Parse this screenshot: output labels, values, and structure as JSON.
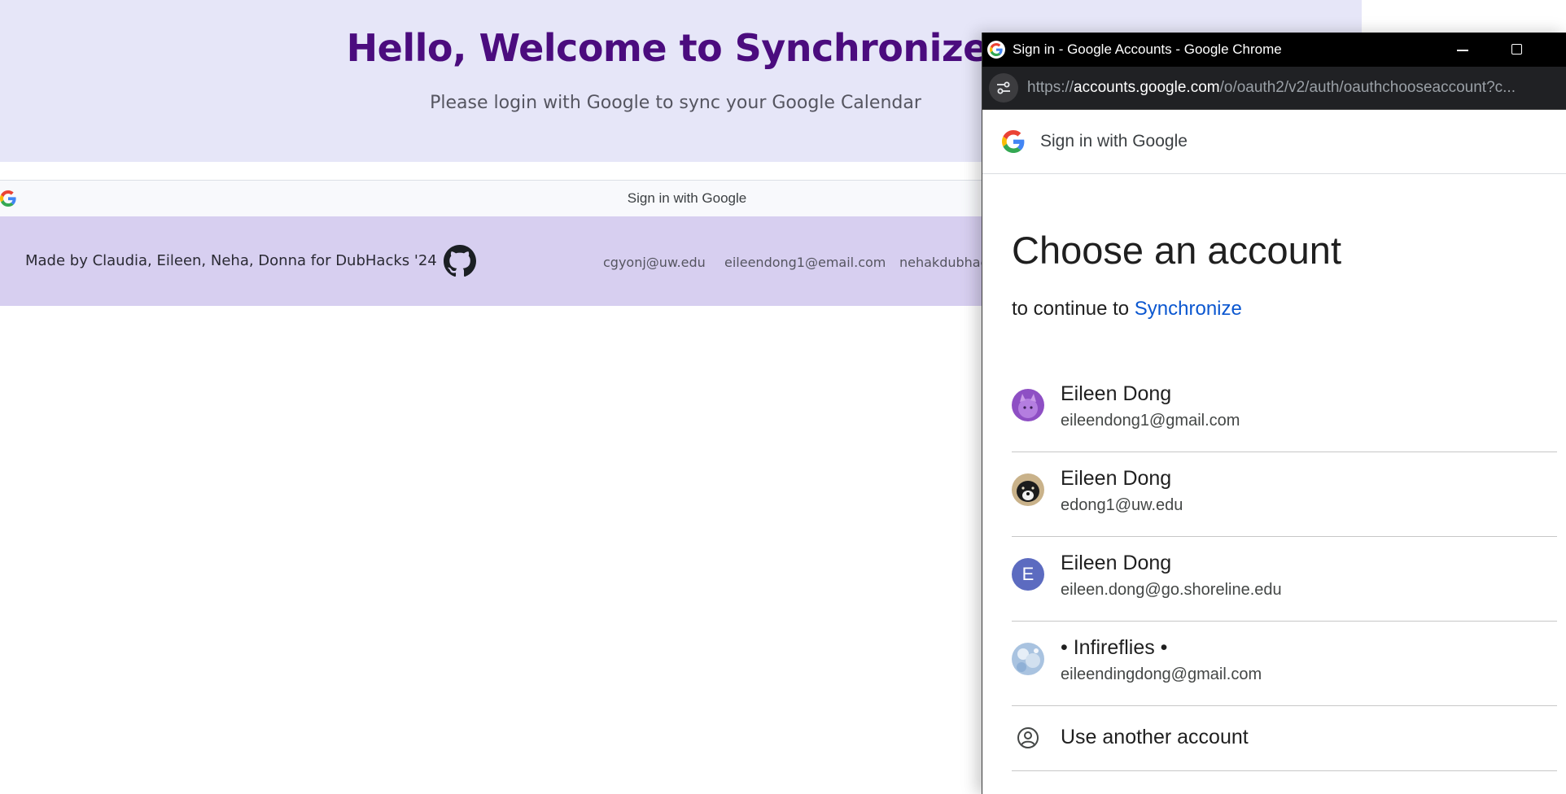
{
  "page": {
    "hero_title": "Hello, Welcome to Synchronize!",
    "hero_subtitle": "Please login with Google to sync your Google Calendar",
    "google_signin_label": "Sign in with Google",
    "footer": {
      "made_by": "Made by Claudia, Eileen, Neha, Donna for DubHacks '24",
      "github_icon": "github-icon",
      "emails": [
        "cgyonj@uw.edu",
        "eileendong1@email.com",
        "nehakdubhacks"
      ]
    },
    "colors": {
      "hero_bg": "#e6e6f8",
      "hero_title": "#4b0c7e",
      "footer_bg": "#d7cff0"
    }
  },
  "popup": {
    "window_title": "Sign in - Google Accounts - Google Chrome",
    "url_scheme": "https://",
    "url_host": "accounts.google.com",
    "url_path": "/o/oauth2/v2/auth/oauthchooseaccount?c...",
    "header_label": "Sign in with Google",
    "title": "Choose an account",
    "continue_prefix": "to continue to",
    "app_name": "Synchronize",
    "accounts": [
      {
        "name": "Eileen Dong",
        "email": "eileendong1@gmail.com",
        "avatar": "cat-photo-avatar"
      },
      {
        "name": "Eileen Dong",
        "email": "edong1@uw.edu",
        "avatar": "dog-photo-avatar"
      },
      {
        "name": "Eileen Dong",
        "email": "eileen.dong@go.shoreline.edu",
        "avatar": "letter-avatar",
        "letter": "E"
      },
      {
        "name": "• Infireflies •",
        "email": "eileendingdong@gmail.com",
        "avatar": "sky-photo-avatar"
      }
    ],
    "use_another": "Use another account",
    "colors": {
      "link": "#0b57d0",
      "letter_avatar": "#5c6bc0"
    }
  }
}
